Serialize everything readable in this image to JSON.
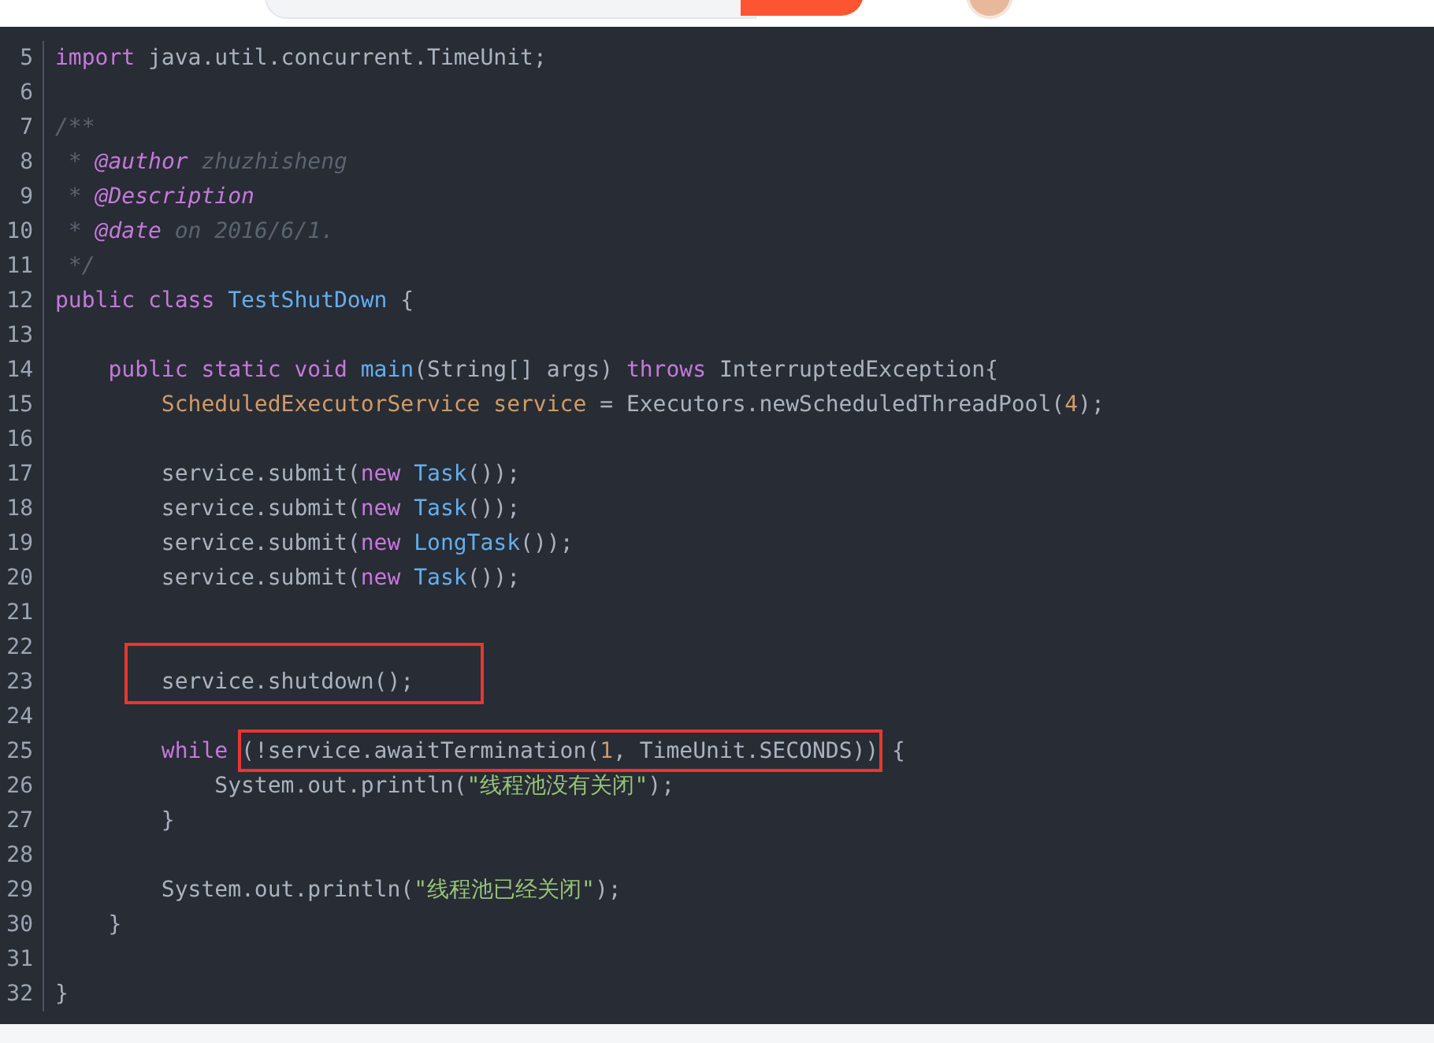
{
  "header": {
    "search_field": {
      "kind": "field"
    },
    "search_button": {
      "kind": "button"
    },
    "avatar": {
      "kind": "avatar"
    }
  },
  "lines": [
    {
      "number": "5",
      "tokens": [
        {
          "kind": "keyword",
          "text": "import"
        },
        {
          "kind": "plain",
          "text": " java.util.concurrent.TimeUnit;"
        }
      ]
    },
    {
      "number": "6"
    },
    {
      "number": "7",
      "tokens": [
        {
          "kind": "comment",
          "text": "/**"
        }
      ]
    },
    {
      "number": "8",
      "tokens": [
        {
          "kind": "comment",
          "text": " * "
        },
        {
          "kind": "tag",
          "text": "@author"
        },
        {
          "kind": "comment",
          "text": " zhuzhisheng"
        }
      ]
    },
    {
      "number": "9",
      "tokens": [
        {
          "kind": "comment",
          "text": " * "
        },
        {
          "kind": "tag",
          "text": "@Description"
        }
      ]
    },
    {
      "number": "10",
      "tokens": [
        {
          "kind": "comment",
          "text": " * "
        },
        {
          "kind": "tag",
          "text": "@date"
        },
        {
          "kind": "comment",
          "text": " on 2016/6/1."
        }
      ]
    },
    {
      "number": "11",
      "tokens": [
        {
          "kind": "comment",
          "text": " */"
        }
      ]
    },
    {
      "number": "12",
      "tokens": [
        {
          "kind": "keyword",
          "text": "public class "
        },
        {
          "kind": "type",
          "text": "TestShutDown"
        },
        {
          "kind": "plain",
          "text": " {"
        }
      ]
    },
    {
      "number": "13"
    },
    {
      "number": "14",
      "tokens": [
        {
          "kind": "keyword",
          "text": "    public static void "
        },
        {
          "kind": "type",
          "text": "main"
        },
        {
          "kind": "plain",
          "text": "(String[] args) "
        },
        {
          "kind": "keyword",
          "text": "throws"
        },
        {
          "kind": "plain",
          "text": " InterruptedException{"
        }
      ]
    },
    {
      "number": "15",
      "tokens": [
        {
          "kind": "variable",
          "text": "        ScheduledExecutorService service"
        },
        {
          "kind": "plain",
          "text": " = Executors.newScheduledThreadPool("
        },
        {
          "kind": "number",
          "text": "4"
        },
        {
          "kind": "plain",
          "text": ");"
        }
      ]
    },
    {
      "number": "16"
    },
    {
      "number": "17",
      "tokens": [
        {
          "kind": "plain",
          "text": "        service.submit("
        },
        {
          "kind": "keyword",
          "text": "new "
        },
        {
          "kind": "type",
          "text": "Task"
        },
        {
          "kind": "plain",
          "text": "());"
        }
      ]
    },
    {
      "number": "18",
      "tokens": [
        {
          "kind": "plain",
          "text": "        service.submit("
        },
        {
          "kind": "keyword",
          "text": "new "
        },
        {
          "kind": "type",
          "text": "Task"
        },
        {
          "kind": "plain",
          "text": "());"
        }
      ]
    },
    {
      "number": "19",
      "tokens": [
        {
          "kind": "plain",
          "text": "        service.submit("
        },
        {
          "kind": "keyword",
          "text": "new "
        },
        {
          "kind": "type",
          "text": "LongTask"
        },
        {
          "kind": "plain",
          "text": "());"
        }
      ]
    },
    {
      "number": "20",
      "tokens": [
        {
          "kind": "plain",
          "text": "        service.submit("
        },
        {
          "kind": "keyword",
          "text": "new "
        },
        {
          "kind": "type",
          "text": "Task"
        },
        {
          "kind": "plain",
          "text": "());"
        }
      ]
    },
    {
      "number": "21"
    },
    {
      "number": "22"
    },
    {
      "number": "23",
      "tokens": [
        {
          "kind": "plain",
          "text": "        service.shutdown();",
          "boxed": true
        }
      ]
    },
    {
      "number": "24"
    },
    {
      "number": "25",
      "tokens": [
        {
          "kind": "keyword",
          "text": "        while "
        },
        {
          "kind": "plain",
          "text": "(!service.awaitTermination(",
          "boxed": true
        },
        {
          "kind": "number",
          "text": "1",
          "boxed": true
        },
        {
          "kind": "plain",
          "text": ", TimeUnit.SECONDS))",
          "boxed": true
        },
        {
          "kind": "plain",
          "text": " {"
        }
      ]
    },
    {
      "number": "26",
      "tokens": [
        {
          "kind": "plain",
          "text": "            System.out.println("
        },
        {
          "kind": "string",
          "text": "\"线程池没有关闭\""
        },
        {
          "kind": "plain",
          "text": ");"
        }
      ]
    },
    {
      "number": "27",
      "tokens": [
        {
          "kind": "plain",
          "text": "        }"
        }
      ]
    },
    {
      "number": "28"
    },
    {
      "number": "29",
      "tokens": [
        {
          "kind": "plain",
          "text": "        System.out.println("
        },
        {
          "kind": "string",
          "text": "\"线程池已经关闭\""
        },
        {
          "kind": "plain",
          "text": ");"
        }
      ]
    },
    {
      "number": "30",
      "tokens": [
        {
          "kind": "plain",
          "text": "    }"
        }
      ]
    },
    {
      "number": "31"
    },
    {
      "number": "32",
      "tokens": [
        {
          "kind": "plain",
          "text": "}"
        }
      ]
    }
  ]
}
